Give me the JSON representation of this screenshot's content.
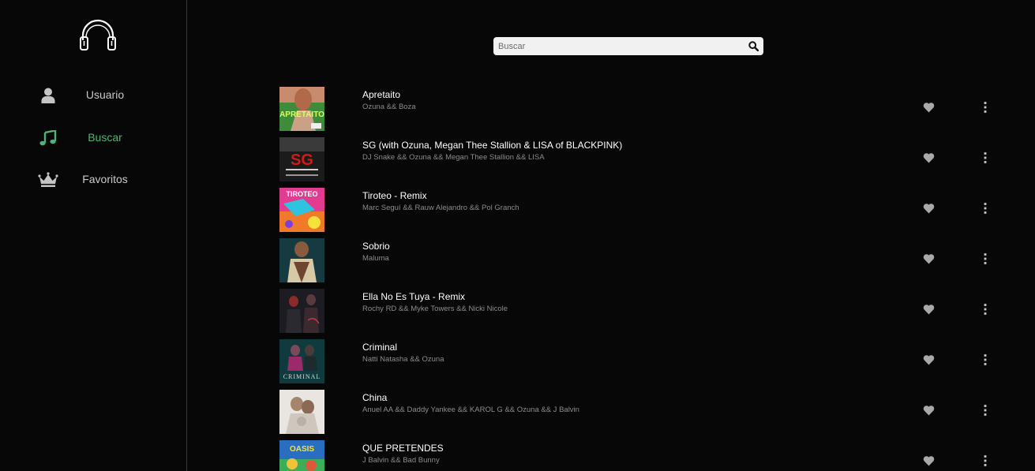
{
  "sidebar": {
    "logo_icon": "headphones-icon",
    "items": [
      {
        "label": "Usuario",
        "icon": "user-icon",
        "active": false
      },
      {
        "label": "Buscar",
        "icon": "music-note-icon",
        "active": true
      },
      {
        "label": "Favoritos",
        "icon": "crown-icon",
        "active": false
      }
    ]
  },
  "search": {
    "placeholder": "Buscar",
    "value": "",
    "icon": "search-icon"
  },
  "colors": {
    "background": "#070707",
    "accent": "#4fb27a",
    "text": "#ffffff",
    "muted": "#8c8c8c"
  },
  "tracks": [
    {
      "title": "Apretaito",
      "artists": "Ozuna && Boza"
    },
    {
      "title": "SG (with Ozuna, Megan Thee Stallion & LISA of BLACKPINK)",
      "artists": "DJ Snake && Ozuna && Megan Thee Stallion && LISA"
    },
    {
      "title": "Tiroteo - Remix",
      "artists": "Marc Seguí && Rauw Alejandro && Pol Granch"
    },
    {
      "title": "Sobrio",
      "artists": "Maluma"
    },
    {
      "title": "Ella No Es Tuya - Remix",
      "artists": "Rochy RD && Myke Towers && Nicki Nicole"
    },
    {
      "title": "Criminal",
      "artists": "Natti Natasha && Ozuna"
    },
    {
      "title": "China",
      "artists": "Anuel AA && Daddy Yankee && KAROL G && Ozuna && J Balvin"
    },
    {
      "title": "QUE PRETENDES",
      "artists": "J Balvin && Bad Bunny"
    }
  ],
  "cover_art": {
    "apretaito": "APRETAITO",
    "sg": "SG",
    "tiroteo": "TIROTEO",
    "criminal": "CRIMINAL",
    "oasis": "OASIS"
  }
}
